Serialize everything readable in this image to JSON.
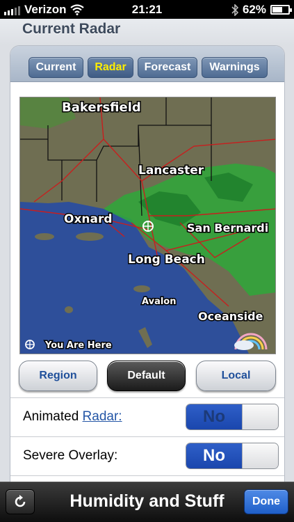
{
  "status_bar": {
    "carrier": "Verizon",
    "time": "21:21",
    "battery_percent": "62%",
    "battery_level": 0.62,
    "icons": [
      "signal-bars-icon",
      "wifi-icon",
      "bluetooth-icon",
      "battery-icon"
    ]
  },
  "page": {
    "title": "Current Radar"
  },
  "tabs": [
    {
      "label": "Current",
      "active": false
    },
    {
      "label": "Radar",
      "active": true
    },
    {
      "label": "Forecast",
      "active": false
    },
    {
      "label": "Warnings",
      "active": false
    }
  ],
  "map": {
    "cities": [
      "Bakersfield",
      "Lancaster",
      "Oxnard",
      "San Bernardi",
      "Long Beach",
      "Avalon",
      "Oceanside"
    ],
    "you_are_here": "You Are Here",
    "colors": {
      "ocean": "#2e4f9a",
      "land": "#6f6e52",
      "precip": "#2fa83a",
      "roads": "#c81e1e"
    }
  },
  "view_buttons": [
    {
      "label": "Region",
      "selected": false
    },
    {
      "label": "Default",
      "selected": true
    },
    {
      "label": "Local",
      "selected": false
    }
  ],
  "settings": {
    "animated": {
      "label_prefix": "Animated ",
      "label_link": "Radar:",
      "value": "No"
    },
    "severe": {
      "label": "Severe Overlay:",
      "value": "No"
    }
  },
  "toolbar": {
    "title": "Humidity and Stuff",
    "done_label": "Done",
    "refresh_icon": "refresh-icon"
  },
  "colors": {
    "accent": "#1f5fc8",
    "tab_active_text": "#ffee00"
  }
}
